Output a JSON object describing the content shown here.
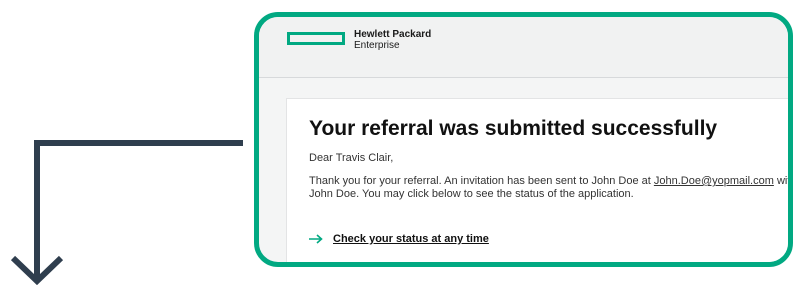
{
  "brand": {
    "name_line1": "Hewlett Packard",
    "name_line2": "Enterprise",
    "logo_icon": "hpe-green-rectangle-logo",
    "accent_color": "#01a982"
  },
  "email": {
    "title": "Your referral was submitted successfully",
    "greeting": "Dear Travis Clair,",
    "body_prefix": "Thank you for your referral. An invitation has been sent to John Doe at",
    "email_link": "John.Doe@yopmail.com",
    "body_suffix": "with John Doe. You may click below to see the status of the application.",
    "cta_label": "Check your status at any time",
    "cta_icon": "arrow-right-icon"
  },
  "flow_arrow": {
    "icon": "arrow-down-icon",
    "color": "#2f3e4e"
  }
}
